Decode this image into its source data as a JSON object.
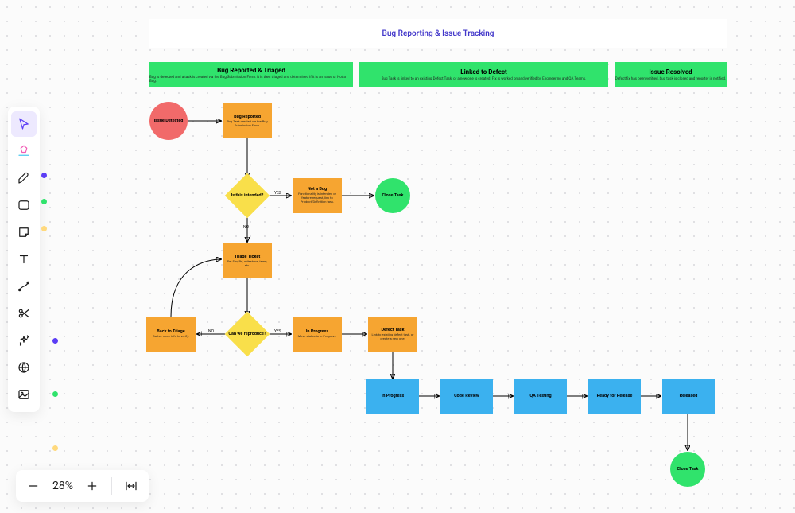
{
  "title": "Bug Reporting & Issue Tracking",
  "lanes": {
    "reported": {
      "title": "Bug Reported & Triaged",
      "sub": "Bug is detected and a task is created via the Bug Submission Form. It is then triaged and determined if it is an issue or Not a Bug."
    },
    "linked": {
      "title": "Linked to Defect",
      "sub": "Bug Task is linked to an existing Defect Task, or a new one is created. Fix is worked on and verified by Engineering and QA Teams."
    },
    "resolved": {
      "title": "Issue Resolved",
      "sub": "Defect fix has been verified, bug task is closed and reporter is notified."
    }
  },
  "nodes": {
    "issue_detected": {
      "title": "Issue Detected"
    },
    "bug_reported": {
      "title": "Bug Reported",
      "sub": "Bug Task created via the Bug Submission Form."
    },
    "is_intended": {
      "title": "Is this intended?"
    },
    "not_a_bug": {
      "title": "Not a Bug",
      "sub": "Functionality is intended or feature request, link to Product/Definition task."
    },
    "close_task_1": {
      "title": "Close Task"
    },
    "triage": {
      "title": "Triage Ticket",
      "sub": "Set Sev, Pri, milestone, team, etc."
    },
    "can_repro": {
      "title": "Can we reproduce?"
    },
    "back_triage": {
      "title": "Back to Triage",
      "sub": "Gather more info to verify."
    },
    "in_prog_1": {
      "title": "In Progress",
      "sub": "Move status to In Progress."
    },
    "defect_task": {
      "title": "Defect Task",
      "sub": "Link to existing defect task, or create a new one."
    },
    "in_prog_2": {
      "title": "In Progress"
    },
    "code_review": {
      "title": "Code Review"
    },
    "qa_testing": {
      "title": "QA Testing"
    },
    "ready_release": {
      "title": "Ready for Release"
    },
    "released": {
      "title": "Released"
    },
    "close_task_2": {
      "title": "Close Task"
    }
  },
  "labels": {
    "yes": "YES",
    "no": "NO"
  },
  "zoom": {
    "value": "28%"
  }
}
